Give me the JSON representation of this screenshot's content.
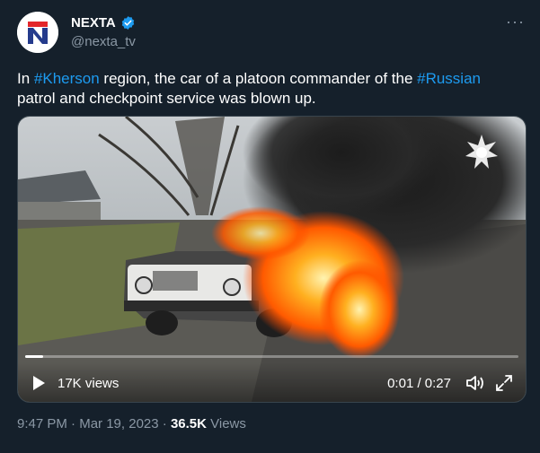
{
  "author": {
    "display_name": "NEXTA",
    "handle": "@nexta_tv",
    "verified": true,
    "avatar_colors": {
      "bg": "#ffffff",
      "red": "#e3262a",
      "blue": "#253b8c"
    }
  },
  "more_button": {
    "label": "···"
  },
  "tweet": {
    "text_parts": {
      "p1": "In ",
      "tag1": "#Kherson",
      "p2": " region, the car of a platoon commander of the ",
      "tag2": "#Russian",
      "p3": " patrol and checkpoint service was blown up."
    }
  },
  "video": {
    "views_label": "17K views",
    "time_label": "0:01 / 0:27",
    "progress_fraction": 0.037,
    "icons": [
      "play-icon",
      "volume-icon",
      "fullscreen-icon",
      "emblem-icon"
    ]
  },
  "meta": {
    "time": "9:47 PM",
    "separator1": " · ",
    "date": "Mar 19, 2023",
    "separator2": " · ",
    "views_count": "36.5K",
    "views_word": " Views"
  },
  "colors": {
    "background": "#15202b",
    "text": "#ffffff",
    "secondary": "#8b98a5",
    "accent": "#1d9bf0",
    "border": "#38444d"
  }
}
